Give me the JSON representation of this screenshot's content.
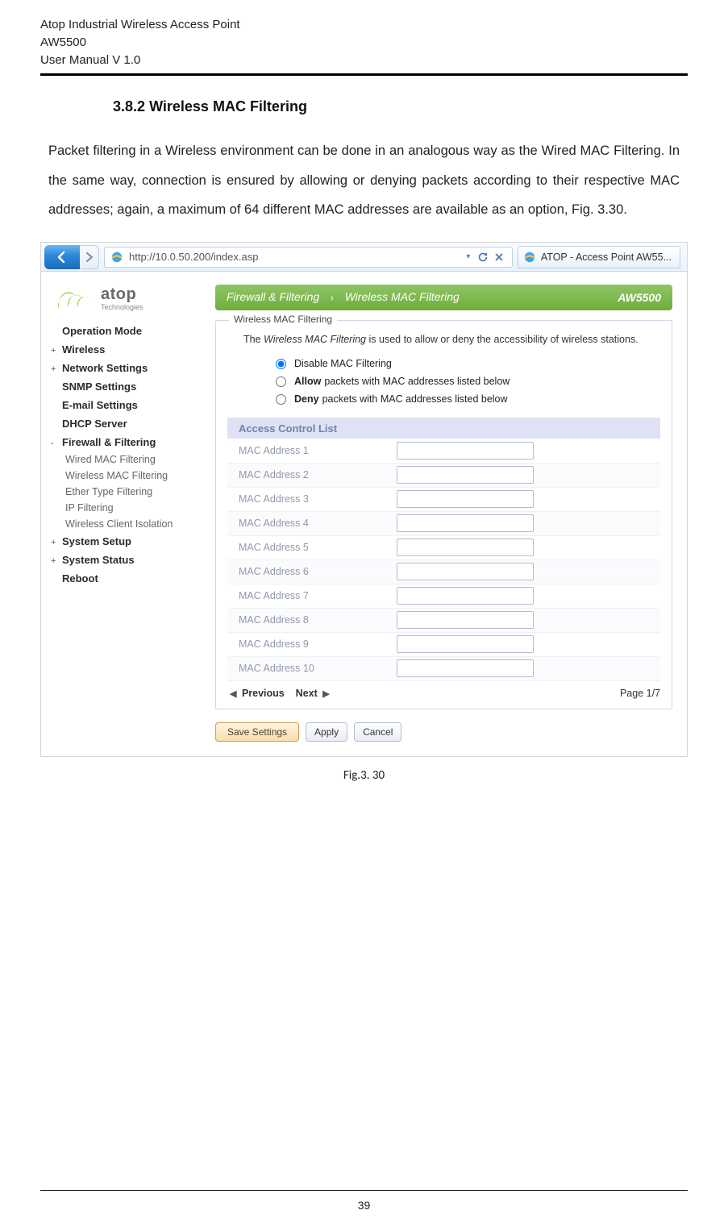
{
  "header": {
    "line1": "Atop Industrial Wireless Access Point",
    "line2": "AW5500",
    "line3": "User Manual V 1.0"
  },
  "section": {
    "number": "3.8.2",
    "title": "Wireless MAC Filtering"
  },
  "paragraph": "Packet filtering in a Wireless environment can be done in an analogous way as the Wired MAC Filtering. In the same way, connection is ensured by allowing or denying packets according to their respective MAC addresses; again, a maximum of 64 different MAC addresses are available as an option, Fig. 3.30.",
  "browser": {
    "url": "http://10.0.50.200/index.asp",
    "tab_title": "ATOP - Access Point AW55..."
  },
  "logo": {
    "brand": "atop",
    "sub": "Technologies"
  },
  "sidebar": {
    "items": [
      {
        "mark": "",
        "label": "Operation Mode",
        "bold": true
      },
      {
        "mark": "+",
        "label": "Wireless",
        "bold": true
      },
      {
        "mark": "+",
        "label": "Network Settings",
        "bold": true
      },
      {
        "mark": "",
        "label": "SNMP Settings",
        "bold": true
      },
      {
        "mark": "",
        "label": "E-mail Settings",
        "bold": true
      },
      {
        "mark": "",
        "label": "DHCP Server",
        "bold": true
      },
      {
        "mark": "-",
        "label": "Firewall & Filtering",
        "bold": true,
        "sub": [
          "Wired MAC Filtering",
          "Wireless MAC Filtering",
          "Ether Type Filtering",
          "IP Filtering",
          "Wireless Client Isolation"
        ]
      },
      {
        "mark": "+",
        "label": "System Setup",
        "bold": true
      },
      {
        "mark": "+",
        "label": "System Status",
        "bold": true
      },
      {
        "mark": "",
        "label": "Reboot",
        "bold": true
      }
    ]
  },
  "mainTitle": {
    "crumb1": "Firewall & Filtering",
    "crumb2": "Wireless MAC Filtering",
    "device": "AW5500"
  },
  "filtering": {
    "legend": "Wireless MAC Filtering",
    "desc_prefix": "The ",
    "desc_em": "Wireless MAC Filtering",
    "desc_suffix": " is used to allow or deny the accessibility of wireless stations.",
    "radios": [
      {
        "bold": "",
        "text": "Disable MAC Filtering",
        "checked": true
      },
      {
        "bold": "Allow",
        "text": "packets with MAC addresses listed below",
        "checked": false
      },
      {
        "bold": "Deny",
        "text": "packets with MAC addresses listed below",
        "checked": false
      }
    ]
  },
  "acl": {
    "header": "Access Control List",
    "rows": [
      "MAC Address 1",
      "MAC Address 2",
      "MAC Address 3",
      "MAC Address 4",
      "MAC Address 5",
      "MAC Address 6",
      "MAC Address 7",
      "MAC Address 8",
      "MAC Address 9",
      "MAC Address 10"
    ]
  },
  "pager": {
    "prev": "Previous",
    "next": "Next",
    "page": "Page 1/7"
  },
  "buttons": {
    "save": "Save Settings",
    "apply": "Apply",
    "cancel": "Cancel"
  },
  "figcaption": "Fig.3. 30",
  "page_number": "39"
}
